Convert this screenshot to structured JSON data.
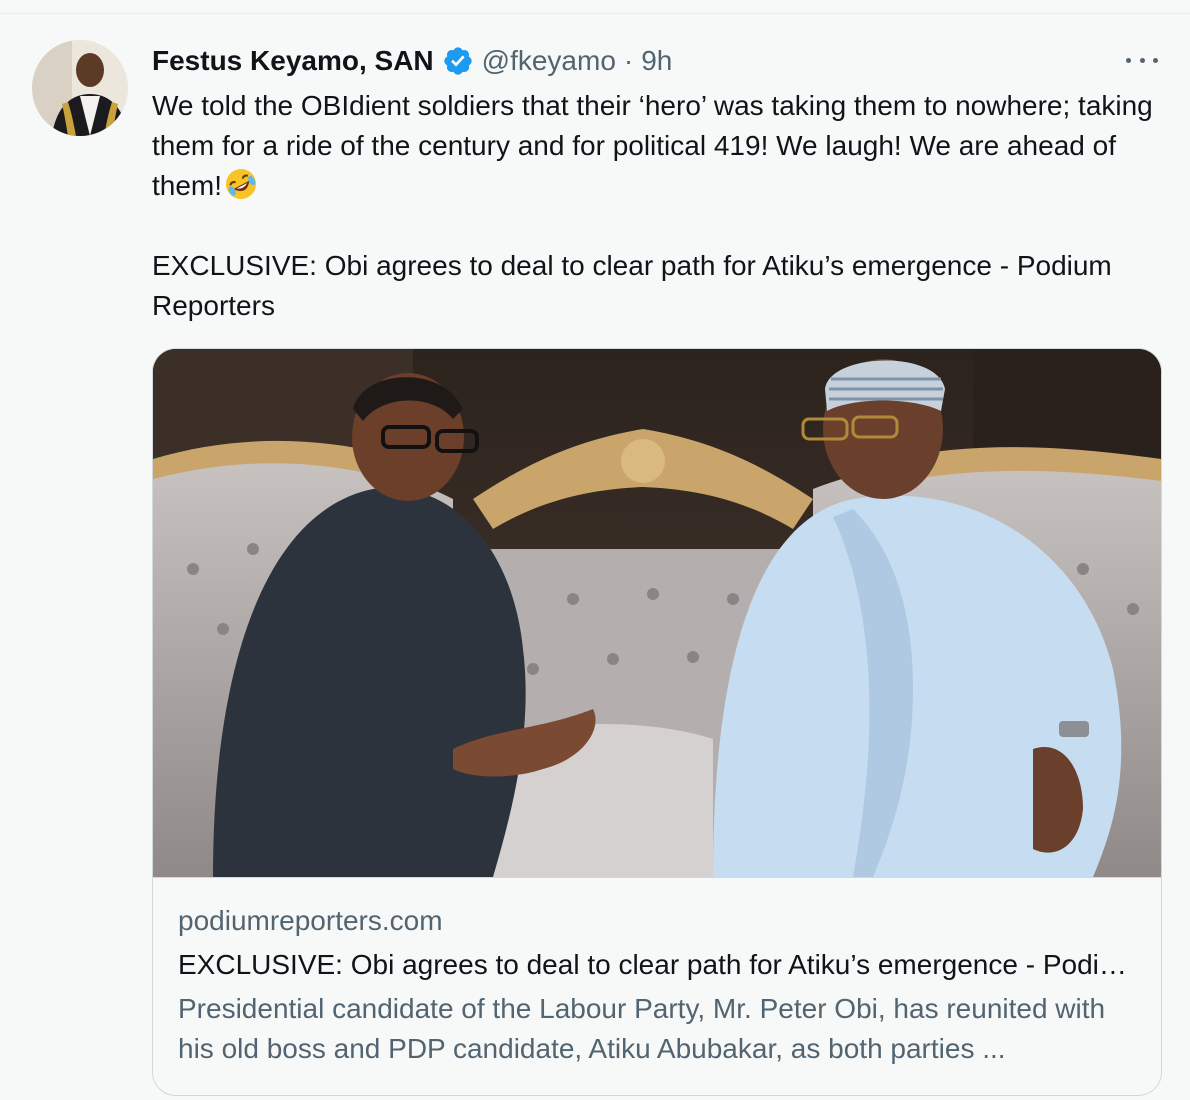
{
  "tweet": {
    "author": {
      "display_name": "Festus Keyamo, SAN",
      "handle": "@fkeyamo",
      "separator": "·",
      "time": "9h",
      "verified": true,
      "avatar_icon": "author-avatar"
    },
    "more_icon": "more-options-icon",
    "text_lines": {
      "paragraph1": "We told the OBIdient soldiers that their ‘hero’ was taking them to nowhere; taking them for a ride of the century and for political 419! We laugh! We are ahead of them!",
      "emoji": "rolling-on-floor-laughing-emoji",
      "paragraph2": "EXCLUSIVE: Obi agrees to deal to clear path for Atiku’s emergence - Podium Reporters"
    },
    "card": {
      "domain": "podiumreporters.com",
      "title": "EXCLUSIVE: Obi agrees to deal to clear path for Atiku’s emergence - Podium Reporters",
      "description": "Presidential candidate of the Labour Party, Mr. Peter Obi, has reunited with his old boss and PDP candidate, Atiku Abubakar, as both parties ...",
      "image_icon": "news-photo"
    },
    "colors": {
      "text": "#0f1419",
      "secondary": "#536471",
      "verified_blue": "#1d9bf0",
      "border": "#cfd9de",
      "background": "#f7f9f9"
    }
  }
}
